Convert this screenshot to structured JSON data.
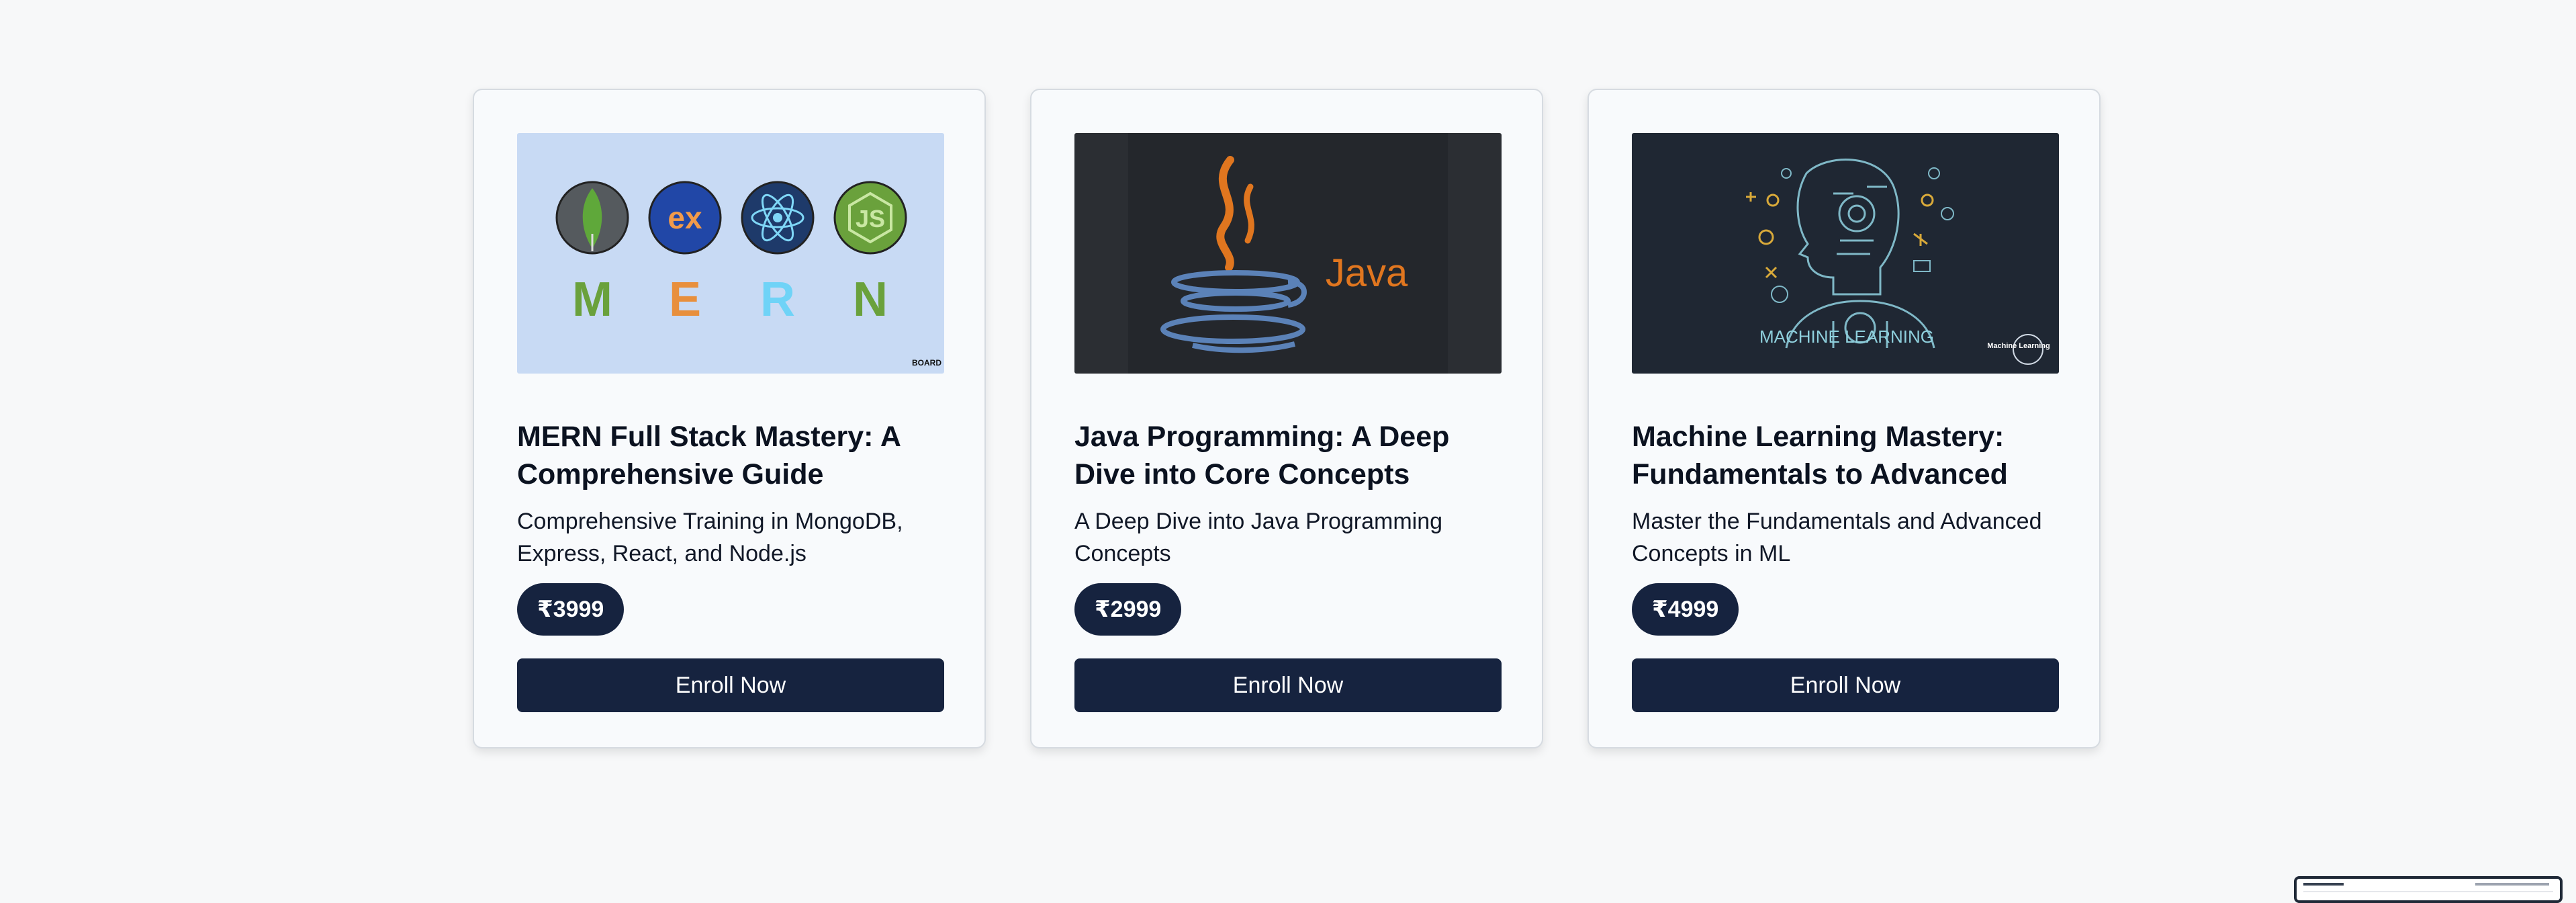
{
  "courses": [
    {
      "title": "MERN Full Stack Mastery: A Comprehensive Guide",
      "description": "Comprehensive Training in MongoDB, Express, React, and Node.js",
      "price": "₹3999",
      "cta": "Enroll Now",
      "thumbnail": {
        "bg": "#c8daf4",
        "badges": [
          "ex",
          "JS"
        ],
        "letters": [
          "M",
          "E",
          "R",
          "N"
        ],
        "letter_colors": [
          "#6aa13c",
          "#e88f3c",
          "#6fd3f7",
          "#6aa13c"
        ],
        "watermark": "BOARD"
      }
    },
    {
      "title": "Java Programming: A Deep Dive into Core Concepts",
      "description": "A Deep Dive into Java Programming Concepts",
      "price": "₹2999",
      "cta": "Enroll Now",
      "thumbnail": {
        "bg": "#2b2e33",
        "logo_text": "Java",
        "logo_color": "#e0761f"
      }
    },
    {
      "title": "Machine Learning Mastery: Fundamentals to Advanced",
      "description": "Master the Fundamentals and Advanced Concepts in ML",
      "price": "₹4999",
      "cta": "Enroll Now",
      "thumbnail": {
        "bg": "#1f2733",
        "caption": "MACHINE LEARNING",
        "watermark": "Machine Learning"
      }
    }
  ],
  "colors": {
    "accent": "#16233f",
    "page_bg": "#f7f8f9"
  }
}
